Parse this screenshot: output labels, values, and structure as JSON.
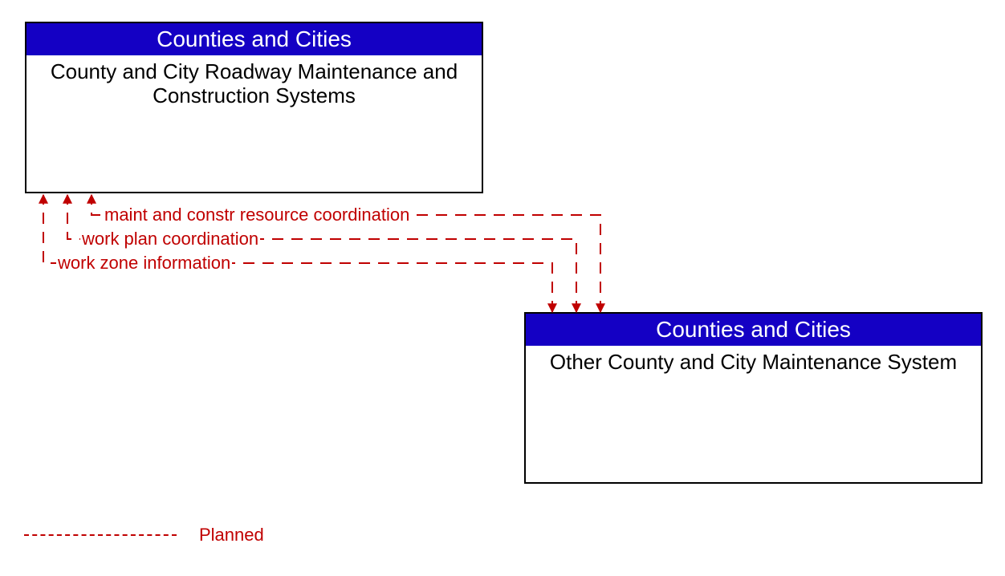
{
  "boxes": {
    "top": {
      "header": "Counties and Cities",
      "body": "County and City Roadway Maintenance and Construction Systems"
    },
    "bottom": {
      "header": "Counties and Cities",
      "body": "Other County and City Maintenance System"
    }
  },
  "flows": {
    "f1": "maint and constr resource coordination",
    "f2": "work plan coordination",
    "f3": "work zone information"
  },
  "legend": {
    "planned": "Planned"
  },
  "colors": {
    "header_bg": "#1400c4",
    "flow": "#c00000"
  }
}
